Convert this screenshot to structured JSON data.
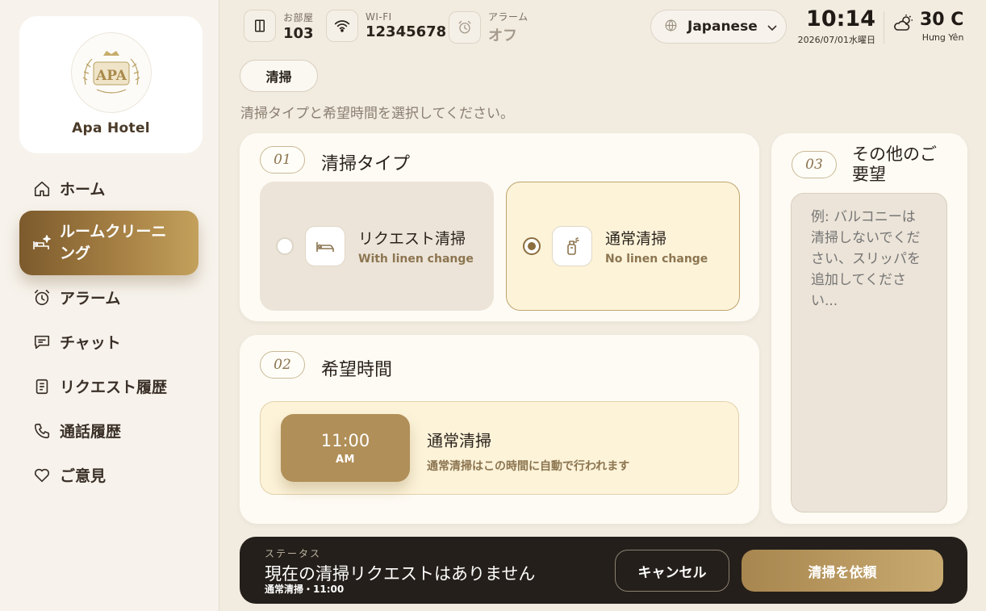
{
  "sidebar": {
    "hotel_name": "Apa Hotel",
    "logo_text": "APA",
    "items": [
      {
        "label": "ホーム",
        "icon": "home-icon"
      },
      {
        "label": "ルームクリーニング",
        "icon": "bed-sparkle-icon",
        "active": true
      },
      {
        "label": "アラーム",
        "icon": "alarm-clock-icon"
      },
      {
        "label": "チャット",
        "icon": "chat-icon"
      },
      {
        "label": "リクエスト履歴",
        "icon": "document-icon"
      },
      {
        "label": "通話履歴",
        "icon": "phone-icon"
      },
      {
        "label": "ご意見",
        "icon": "heart-icon"
      }
    ]
  },
  "topbar": {
    "room": {
      "label": "お部屋",
      "value": "103",
      "icon": "door-icon"
    },
    "wifi": {
      "label": "WI-FI",
      "value": "12345678",
      "icon": "wifi-icon"
    },
    "alarm": {
      "label": "アラーム",
      "value": "オフ",
      "icon": "alarm-clock-icon"
    },
    "language": {
      "value": "Japanese",
      "icon": "globe-icon"
    },
    "time": "10:14",
    "date": "2026/07/01水曜日",
    "weather": {
      "temp": "30 C",
      "place": "Hưng Yên",
      "icon": "partly-cloudy-icon"
    }
  },
  "page": {
    "chip": "清掃",
    "subtitle": "清掃タイプと希望時間を選択してください。"
  },
  "cleaning_type": {
    "step": "01",
    "title": "清掃タイプ",
    "options": [
      {
        "title": "リクエスト清掃",
        "sub": "With linen change",
        "selected": false,
        "icon": "bed-icon"
      },
      {
        "title": "通常清掃",
        "sub": "No linen change",
        "selected": true,
        "icon": "spray-icon"
      }
    ]
  },
  "preferred_time": {
    "step": "02",
    "title": "希望時間",
    "time": "11:00",
    "ampm": "AM",
    "desc_title": "通常清掃",
    "desc_sub": "通常清掃はこの時間に自動で行われます"
  },
  "other_requests": {
    "step": "03",
    "title": "その他のご要望",
    "placeholder": "例: バルコニーは清掃しないでください、スリッパを追加してください..."
  },
  "status": {
    "label": "ステータス",
    "main": "現在の清掃リクエストはありません",
    "sub": "通常清掃・11:00",
    "cancel": "キャンセル",
    "submit": "清掃を依頼"
  },
  "colors": {
    "accent": "#b08f58",
    "accent_dark": "#7c5a2c",
    "background": "#f1ebe0",
    "card": "#fefbf4",
    "status_bar": "#241f1a"
  }
}
